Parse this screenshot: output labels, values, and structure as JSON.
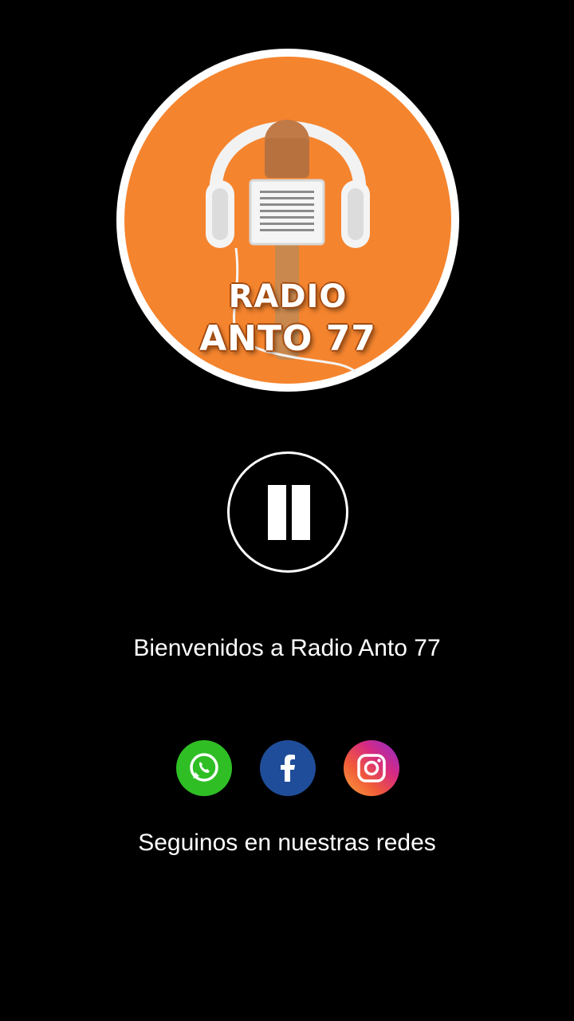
{
  "logo": {
    "line1": "RADIO",
    "line2": "ANTO 77",
    "colors": {
      "background": "#f5842e",
      "ring": "#ffffff",
      "mic": "#c9894e"
    }
  },
  "player": {
    "state": "playing",
    "control_icon": "pause-icon"
  },
  "welcome_text": "Bienvenidos a Radio Anto 77",
  "social": {
    "links": [
      {
        "name": "whatsapp",
        "icon": "whatsapp-icon",
        "color": "#2fbf25"
      },
      {
        "name": "facebook",
        "icon": "facebook-icon",
        "color": "#1f4d99"
      },
      {
        "name": "instagram",
        "icon": "instagram-icon",
        "color": "#d62a82"
      }
    ],
    "caption": "Seguinos en nuestras redes"
  }
}
